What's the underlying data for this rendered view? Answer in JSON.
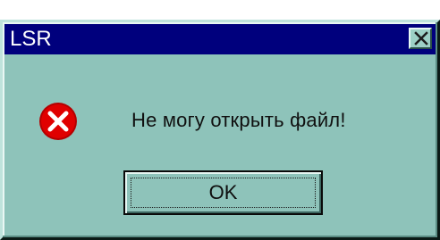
{
  "window": {
    "title": "LSR"
  },
  "dialog": {
    "message": "Не могу открыть файл!",
    "ok_label": "OK"
  },
  "icons": {
    "close": "close-icon",
    "error": "error-icon"
  },
  "colors": {
    "titlebar": "#00007d",
    "dialog_background": "#8ec3ba",
    "error_red": "#e00000"
  }
}
